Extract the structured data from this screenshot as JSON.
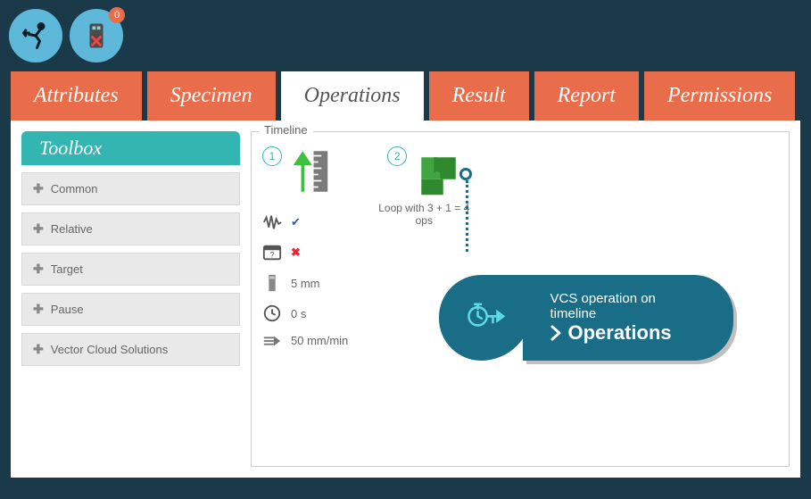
{
  "toolbar": {
    "exit_icon": "exit",
    "device_icon": "device",
    "device_badge": "0"
  },
  "tabs": [
    {
      "label": "Attributes",
      "active": false
    },
    {
      "label": "Specimen",
      "active": false
    },
    {
      "label": "Operations",
      "active": true
    },
    {
      "label": "Result",
      "active": false
    },
    {
      "label": "Report",
      "active": false
    },
    {
      "label": "Permissions",
      "active": false
    }
  ],
  "toolbox": {
    "title": "Toolbox",
    "items": [
      {
        "label": "Common"
      },
      {
        "label": "Relative"
      },
      {
        "label": "Target"
      },
      {
        "label": "Pause"
      },
      {
        "label": "Vector Cloud Solutions"
      }
    ]
  },
  "timeline": {
    "label": "Timeline",
    "nodes": [
      {
        "num": "1"
      },
      {
        "num": "2",
        "caption": "Loop with 3 + 1 = 4 ops"
      }
    ],
    "node1_props": {
      "wave_ok": "✔",
      "question_x": "✖",
      "distance": "5 mm",
      "time": "0 s",
      "speed": "50 mm/min"
    }
  },
  "callout": {
    "line1": "VCS operation on timeline",
    "line2": "Operations"
  }
}
